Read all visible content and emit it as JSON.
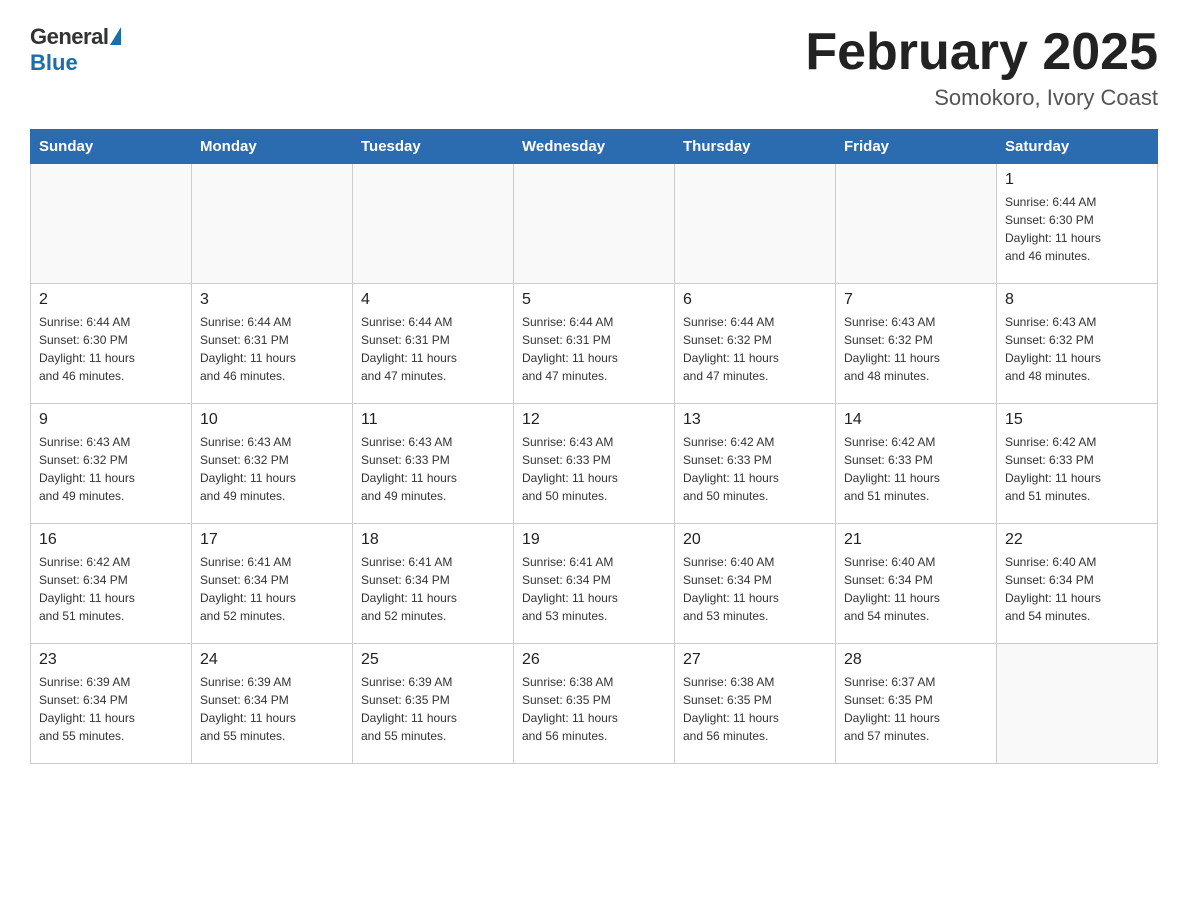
{
  "logo": {
    "general": "General",
    "blue": "Blue"
  },
  "title": "February 2025",
  "location": "Somokoro, Ivory Coast",
  "weekdays": [
    "Sunday",
    "Monday",
    "Tuesday",
    "Wednesday",
    "Thursday",
    "Friday",
    "Saturday"
  ],
  "weeks": [
    [
      {
        "day": "",
        "info": ""
      },
      {
        "day": "",
        "info": ""
      },
      {
        "day": "",
        "info": ""
      },
      {
        "day": "",
        "info": ""
      },
      {
        "day": "",
        "info": ""
      },
      {
        "day": "",
        "info": ""
      },
      {
        "day": "1",
        "info": "Sunrise: 6:44 AM\nSunset: 6:30 PM\nDaylight: 11 hours\nand 46 minutes."
      }
    ],
    [
      {
        "day": "2",
        "info": "Sunrise: 6:44 AM\nSunset: 6:30 PM\nDaylight: 11 hours\nand 46 minutes."
      },
      {
        "day": "3",
        "info": "Sunrise: 6:44 AM\nSunset: 6:31 PM\nDaylight: 11 hours\nand 46 minutes."
      },
      {
        "day": "4",
        "info": "Sunrise: 6:44 AM\nSunset: 6:31 PM\nDaylight: 11 hours\nand 47 minutes."
      },
      {
        "day": "5",
        "info": "Sunrise: 6:44 AM\nSunset: 6:31 PM\nDaylight: 11 hours\nand 47 minutes."
      },
      {
        "day": "6",
        "info": "Sunrise: 6:44 AM\nSunset: 6:32 PM\nDaylight: 11 hours\nand 47 minutes."
      },
      {
        "day": "7",
        "info": "Sunrise: 6:43 AM\nSunset: 6:32 PM\nDaylight: 11 hours\nand 48 minutes."
      },
      {
        "day": "8",
        "info": "Sunrise: 6:43 AM\nSunset: 6:32 PM\nDaylight: 11 hours\nand 48 minutes."
      }
    ],
    [
      {
        "day": "9",
        "info": "Sunrise: 6:43 AM\nSunset: 6:32 PM\nDaylight: 11 hours\nand 49 minutes."
      },
      {
        "day": "10",
        "info": "Sunrise: 6:43 AM\nSunset: 6:32 PM\nDaylight: 11 hours\nand 49 minutes."
      },
      {
        "day": "11",
        "info": "Sunrise: 6:43 AM\nSunset: 6:33 PM\nDaylight: 11 hours\nand 49 minutes."
      },
      {
        "day": "12",
        "info": "Sunrise: 6:43 AM\nSunset: 6:33 PM\nDaylight: 11 hours\nand 50 minutes."
      },
      {
        "day": "13",
        "info": "Sunrise: 6:42 AM\nSunset: 6:33 PM\nDaylight: 11 hours\nand 50 minutes."
      },
      {
        "day": "14",
        "info": "Sunrise: 6:42 AM\nSunset: 6:33 PM\nDaylight: 11 hours\nand 51 minutes."
      },
      {
        "day": "15",
        "info": "Sunrise: 6:42 AM\nSunset: 6:33 PM\nDaylight: 11 hours\nand 51 minutes."
      }
    ],
    [
      {
        "day": "16",
        "info": "Sunrise: 6:42 AM\nSunset: 6:34 PM\nDaylight: 11 hours\nand 51 minutes."
      },
      {
        "day": "17",
        "info": "Sunrise: 6:41 AM\nSunset: 6:34 PM\nDaylight: 11 hours\nand 52 minutes."
      },
      {
        "day": "18",
        "info": "Sunrise: 6:41 AM\nSunset: 6:34 PM\nDaylight: 11 hours\nand 52 minutes."
      },
      {
        "day": "19",
        "info": "Sunrise: 6:41 AM\nSunset: 6:34 PM\nDaylight: 11 hours\nand 53 minutes."
      },
      {
        "day": "20",
        "info": "Sunrise: 6:40 AM\nSunset: 6:34 PM\nDaylight: 11 hours\nand 53 minutes."
      },
      {
        "day": "21",
        "info": "Sunrise: 6:40 AM\nSunset: 6:34 PM\nDaylight: 11 hours\nand 54 minutes."
      },
      {
        "day": "22",
        "info": "Sunrise: 6:40 AM\nSunset: 6:34 PM\nDaylight: 11 hours\nand 54 minutes."
      }
    ],
    [
      {
        "day": "23",
        "info": "Sunrise: 6:39 AM\nSunset: 6:34 PM\nDaylight: 11 hours\nand 55 minutes."
      },
      {
        "day": "24",
        "info": "Sunrise: 6:39 AM\nSunset: 6:34 PM\nDaylight: 11 hours\nand 55 minutes."
      },
      {
        "day": "25",
        "info": "Sunrise: 6:39 AM\nSunset: 6:35 PM\nDaylight: 11 hours\nand 55 minutes."
      },
      {
        "day": "26",
        "info": "Sunrise: 6:38 AM\nSunset: 6:35 PM\nDaylight: 11 hours\nand 56 minutes."
      },
      {
        "day": "27",
        "info": "Sunrise: 6:38 AM\nSunset: 6:35 PM\nDaylight: 11 hours\nand 56 minutes."
      },
      {
        "day": "28",
        "info": "Sunrise: 6:37 AM\nSunset: 6:35 PM\nDaylight: 11 hours\nand 57 minutes."
      },
      {
        "day": "",
        "info": ""
      }
    ]
  ]
}
